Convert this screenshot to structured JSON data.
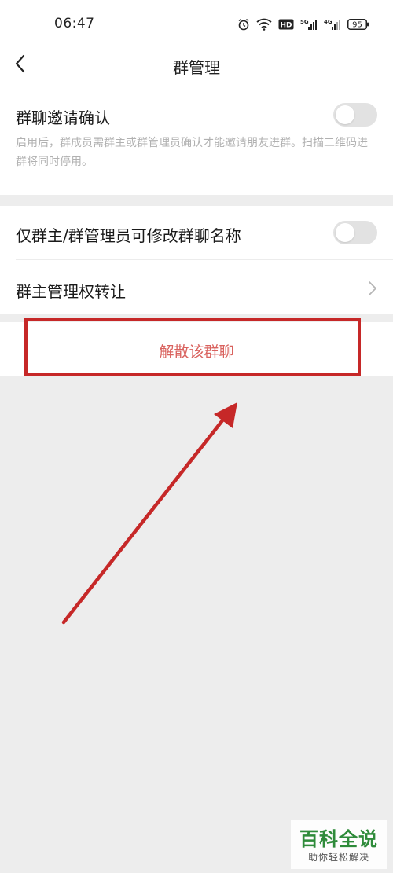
{
  "status_bar": {
    "time": "06:47",
    "network_badge": "HD",
    "signal_1": "5G",
    "signal_2": "4G",
    "battery": "95"
  },
  "nav": {
    "title": "群管理"
  },
  "invite_confirm": {
    "title": "群聊邀请确认",
    "description": "启用后，群成员需群主或群管理员确认才能邀请朋友进群。扫描二维码进群将同时停用。",
    "enabled": false
  },
  "rename_permission": {
    "title": "仅群主/群管理员可修改群聊名称",
    "enabled": false
  },
  "transfer_owner": {
    "title": "群主管理权转让"
  },
  "disband": {
    "label": "解散该群聊"
  },
  "watermark": {
    "main": "百科全说",
    "sub": "助你轻松解决"
  },
  "colors": {
    "background": "#ededed",
    "danger_text": "#d9625e",
    "annotation": "#c62828",
    "toggle_off": "#e2e2e2",
    "watermark_green": "#2e8b3a"
  }
}
